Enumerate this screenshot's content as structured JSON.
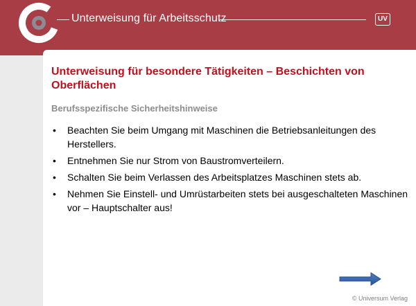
{
  "header": {
    "title": "Unterweisung für Arbeitsschutz",
    "badge": "UV",
    "bg_color": "#a83d45"
  },
  "slide": {
    "title": "Unterweisung für besondere Tätigkeiten – Beschichten von Oberflächen",
    "subtitle": "Berufsspezifische Sicherheitshinweise",
    "bullet_symbol": "•",
    "bullets": [
      "Beachten Sie beim Umgang mit Maschinen die Betriebsanleitungen des Herstellers.",
      "Entnehmen Sie nur Strom von Baustromverteilern.",
      "Schalten Sie beim Verlassen des Arbeitsplatzes Maschinen stets ab.",
      "Nehmen Sie Einstell- und Umrüstarbeiten stets bei ausgeschalteten Maschinen vor – Hauptschalter aus!"
    ],
    "title_color": "#c0101e",
    "subtitle_color": "#8c8c8c"
  },
  "navigation": {
    "next_icon": "arrow-right-icon",
    "arrow_color": "#2e5fa6"
  },
  "footer": {
    "copyright": "© Universum Verlag"
  }
}
